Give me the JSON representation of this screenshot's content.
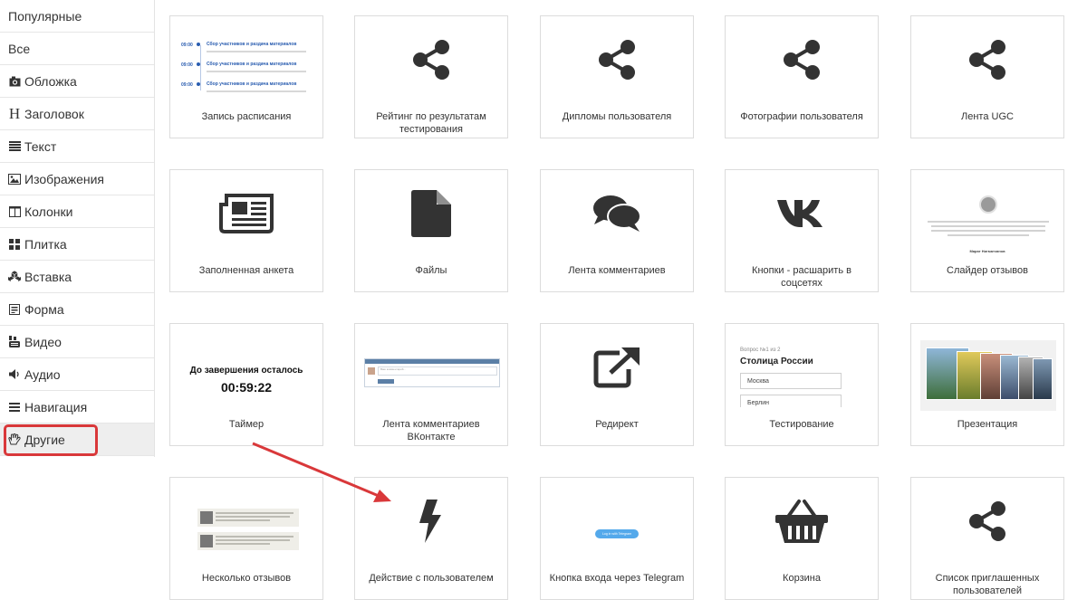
{
  "sidebar": {
    "items": [
      {
        "label": "Популярные",
        "icon": ""
      },
      {
        "label": "Все",
        "icon": ""
      },
      {
        "label": "Обложка",
        "icon": "camera-icon"
      },
      {
        "label": "Заголовок",
        "icon": "heading-icon"
      },
      {
        "label": "Текст",
        "icon": "text-lines-icon"
      },
      {
        "label": "Изображения",
        "icon": "image-icon"
      },
      {
        "label": "Колонки",
        "icon": "columns-icon"
      },
      {
        "label": "Плитка",
        "icon": "tiles-icon"
      },
      {
        "label": "Вставка",
        "icon": "cubes-icon"
      },
      {
        "label": "Форма",
        "icon": "form-icon"
      },
      {
        "label": "Видео",
        "icon": "youtube-icon"
      },
      {
        "label": "Аудио",
        "icon": "speaker-icon"
      },
      {
        "label": "Навигация",
        "icon": "menu-lines-icon"
      },
      {
        "label": "Другие",
        "icon": "hand-icon"
      }
    ],
    "active_index": 13,
    "heading_glyph": "H"
  },
  "cards": [
    {
      "label": "Запись расписания",
      "icon": "schedule-preview"
    },
    {
      "label": "Рейтинг по результатам тестирования",
      "icon": "share-icon"
    },
    {
      "label": "Дипломы пользователя",
      "icon": "share-icon"
    },
    {
      "label": "Фотографии пользователя",
      "icon": "share-icon"
    },
    {
      "label": "Лента UGC",
      "icon": "share-icon"
    },
    {
      "label": "Заполненная анкета",
      "icon": "newspaper-icon"
    },
    {
      "label": "Файлы",
      "icon": "file-icon"
    },
    {
      "label": "Лента комментариев",
      "icon": "comments-icon"
    },
    {
      "label": "Кнопки - расшарить в соцсетях",
      "icon": "vk-icon"
    },
    {
      "label": "Слайдер отзывов",
      "icon": "slider-preview"
    },
    {
      "label": "Таймер",
      "icon": "timer-preview"
    },
    {
      "label": "Лента комментариев ВКонтакте",
      "icon": "vk-comments-preview"
    },
    {
      "label": "Редирект",
      "icon": "external-link-icon"
    },
    {
      "label": "Тестирование",
      "icon": "test-preview"
    },
    {
      "label": "Презентация",
      "icon": "presentation-preview"
    },
    {
      "label": "Несколько отзывов",
      "icon": "reviews-preview"
    },
    {
      "label": "Действие с пользователем",
      "icon": "bolt-icon"
    },
    {
      "label": "Кнопка входа через Telegram",
      "icon": "telegram-button-preview"
    },
    {
      "label": "Корзина",
      "icon": "basket-icon"
    },
    {
      "label": "Список приглашенных пользователей",
      "icon": "share-icon"
    }
  ],
  "previews": {
    "schedule": {
      "rows": [
        {
          "time": "09:00",
          "title": "Сбор участников и раздача материалов"
        },
        {
          "time": "09:00",
          "title": "Сбор участников и раздача материалов"
        },
        {
          "time": "09:00",
          "title": "Сбор участников и раздача материалов"
        }
      ]
    },
    "timer": {
      "title": "До завершения осталось",
      "value": "00:59:22"
    },
    "vk_comments": {
      "placeholder": "Ваш комментарий..."
    },
    "test": {
      "question_no": "Вопрос №1 из 2",
      "question": "Столица России",
      "options": [
        "Москва",
        "Берлин"
      ]
    },
    "slider": {
      "name": "Марат Нигматзянов"
    },
    "telegram": {
      "button": "Log in with Telegram"
    }
  },
  "colors": {
    "accent_red": "#d9383a",
    "icon_dark": "#333333",
    "telegram_blue": "#54a9eb",
    "sidebar_active": "#eeeeee"
  }
}
